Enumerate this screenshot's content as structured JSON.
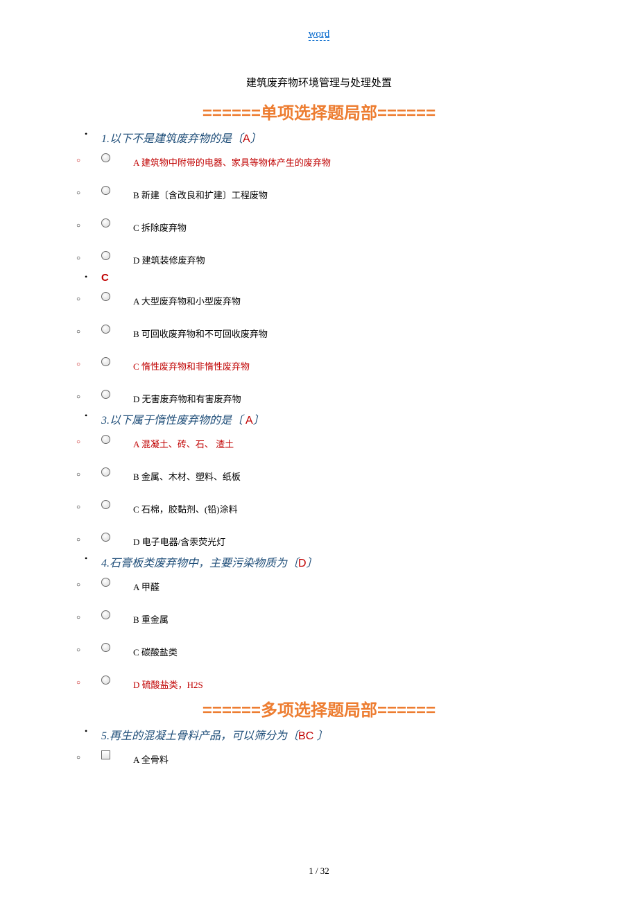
{
  "header": {
    "word_link": "word"
  },
  "title": "建筑废弃物环境管理与处理处置",
  "sections": {
    "single": "======单项选择题局部======",
    "multi": "======多项选择题局部======"
  },
  "q1": {
    "text_prefix": "1.以下不是建筑废弃物的是〔",
    "answer": "A",
    "text_suffix": "〕",
    "a": "A 建筑物中附带的电器、家具等物体产生的废弃物",
    "b": "B 新建〔含改良和扩建〕工程废物",
    "c": "C 拆除废弃物",
    "d": "D 建筑装修废弃物"
  },
  "q2": {
    "answer": "C",
    "a": "A 大型废弃物和小型废弃物",
    "b": "B 可回收废弃物和不可回收废弃物",
    "c": "C 惰性废弃物和非惰性废弃物",
    "d": "D 无害废弃物和有害废弃物"
  },
  "q3": {
    "text_prefix": "3.以下属于惰性废弃物的是〔 ",
    "answer": "A",
    "text_suffix": "〕",
    "a": "A 混凝土、砖、石、 渣土",
    "b": "B 金属、木材、塑料、纸板",
    "c": "C 石棉，胶黏剂、(铅)涂料",
    "d": "D 电子电器/含汞荧光灯"
  },
  "q4": {
    "text_prefix": "4.石膏板类废弃物中，主要污染物质为〔",
    "answer": "D",
    "text_suffix": "〕",
    "a": "A 甲醛",
    "b": "B 重金属",
    "c": "C 碳酸盐类",
    "d": "D 硫酸盐类，H2S"
  },
  "q5": {
    "text_prefix": "5.再生的混凝土骨料产品，可以筛分为〔",
    "answer": "BC ",
    "text_suffix": "〕",
    "a": "A 全骨料"
  },
  "footer": {
    "page": "1 / 32"
  }
}
